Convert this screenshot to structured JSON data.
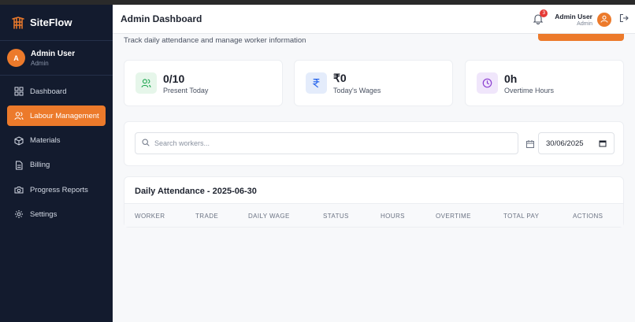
{
  "brand": {
    "name": "SiteFlow"
  },
  "sidebar": {
    "user": {
      "initial": "A",
      "name": "Admin User",
      "role": "Admin"
    },
    "items": [
      {
        "label": "Dashboard",
        "icon": "grid-icon",
        "active": false
      },
      {
        "label": "Labour Management",
        "icon": "users-icon",
        "active": true
      },
      {
        "label": "Materials",
        "icon": "box-icon",
        "active": false
      },
      {
        "label": "Billing",
        "icon": "document-icon",
        "active": false
      },
      {
        "label": "Progress Reports",
        "icon": "camera-icon",
        "active": false
      },
      {
        "label": "Settings",
        "icon": "gear-icon",
        "active": false
      }
    ]
  },
  "header": {
    "title": "Admin Dashboard",
    "notifications": "3",
    "user_name": "Admin User",
    "user_role": "Admin"
  },
  "main": {
    "subtitle": "Track daily attendance and manage worker information",
    "stats": [
      {
        "value": "0/10",
        "label": "Present Today",
        "icon": "users-icon",
        "color": "#16a34a",
        "bg": "#e6f6ea"
      },
      {
        "value": "₹0",
        "label": "Today's Wages",
        "icon": "rupee-icon",
        "color": "#2563eb",
        "bg": "#e4ecfb"
      },
      {
        "value": "0h",
        "label": "Overtime Hours",
        "icon": "clock-icon",
        "color": "#8b3fd1",
        "bg": "#f0e6fb"
      }
    ],
    "search_placeholder": "Search workers...",
    "date": "30/06/2025",
    "attendance": {
      "title": "Daily Attendance - 2025-06-30",
      "columns": [
        "WORKER",
        "TRADE",
        "DAILY WAGE",
        "STATUS",
        "HOURS",
        "OVERTIME",
        "TOTAL PAY",
        "ACTIONS"
      ]
    }
  },
  "colors": {
    "accent": "#ec7a2b",
    "sidebar": "#131b2e"
  }
}
